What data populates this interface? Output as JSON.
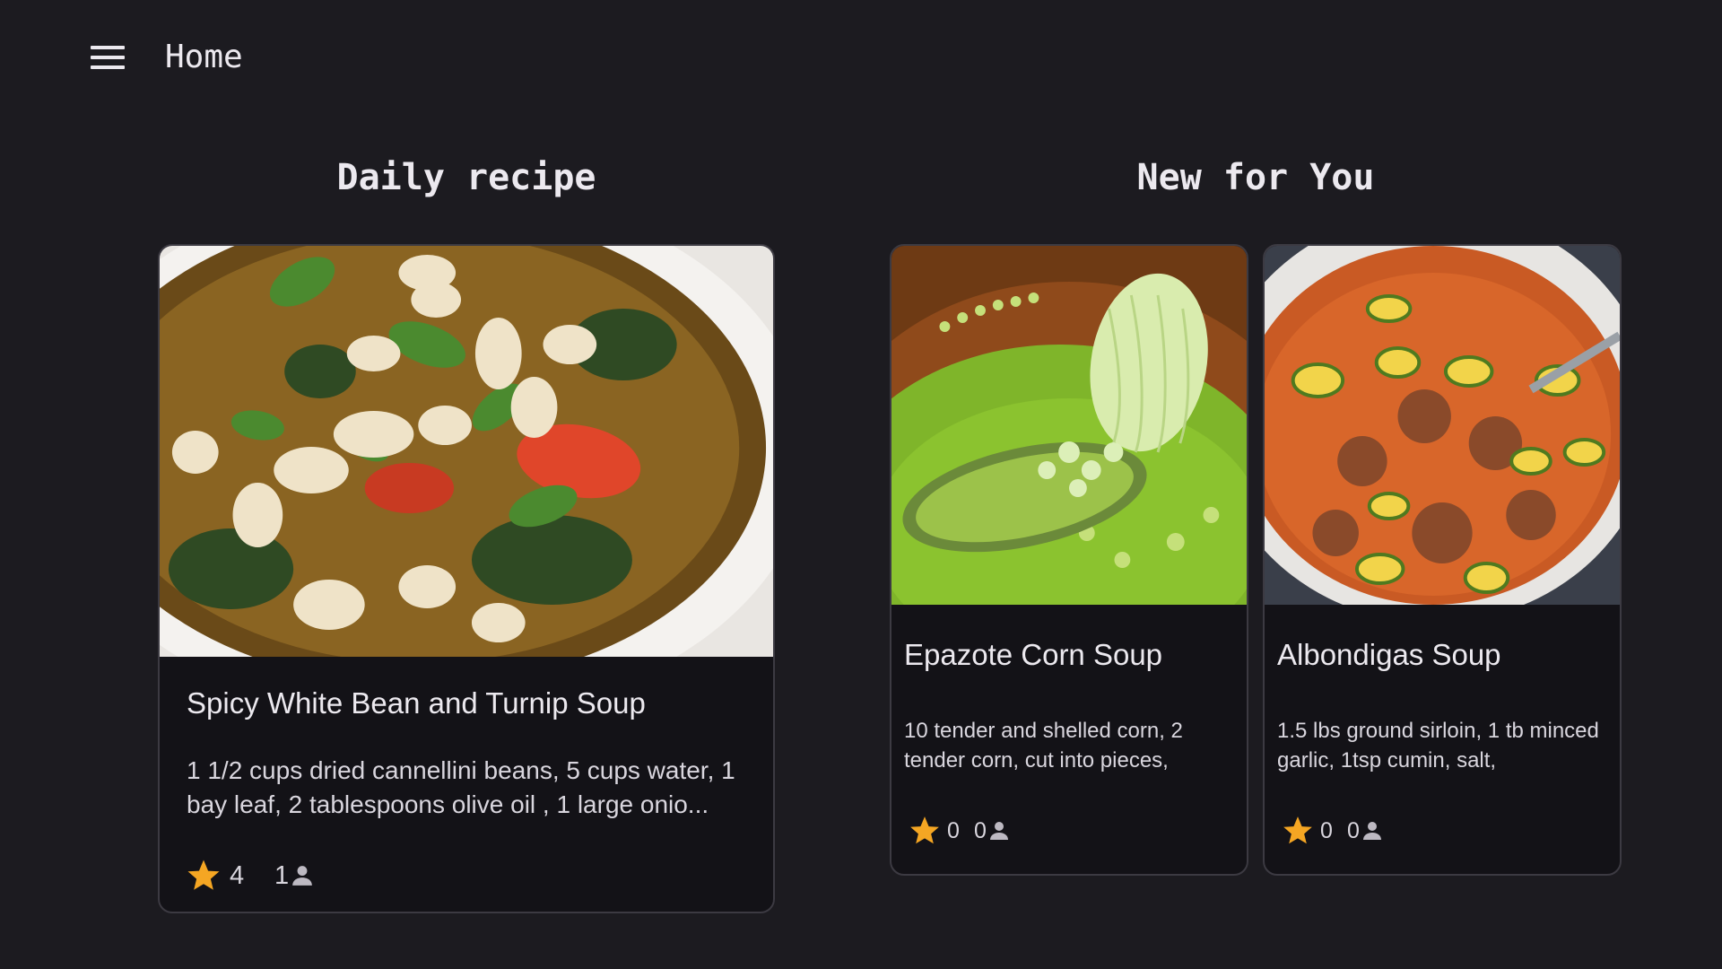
{
  "header": {
    "title": "Home",
    "menu_icon": "hamburger-menu-icon"
  },
  "sections": {
    "daily": {
      "title": "Daily recipe",
      "recipe": {
        "name": "Spicy White Bean and Turnip Soup",
        "description": "1 1/2 cups dried cannellini beans, 5 cups water, 1 bay leaf, 2 tablespoons olive oil , 1 large onio...",
        "rating": "4",
        "reviewers": "1"
      }
    },
    "new_for_you": {
      "title": "New for You",
      "recipes": [
        {
          "name": "Epazote Corn Soup",
          "description": "10 tender and shelled corn, 2 tender corn, cut into pieces,",
          "rating": "0",
          "reviewers": "0"
        },
        {
          "name": "Albondigas Soup",
          "description": "1.5 lbs ground sirloin, 1 tb minced garlic, 1tsp cumin, salt,",
          "rating": "0",
          "reviewers": "0"
        }
      ]
    }
  },
  "icons": {
    "rating": "star-icon",
    "reviewers": "person-icon"
  },
  "colors": {
    "background": "#1c1b20",
    "card": "#131217",
    "card_border": "#3c3a42",
    "text": "#ece9ef",
    "star": "#f5a623"
  }
}
